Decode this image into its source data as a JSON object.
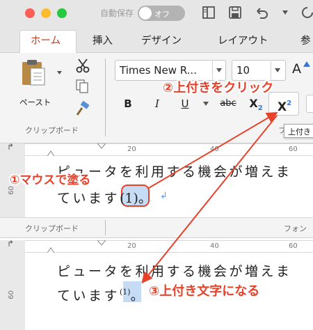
{
  "titlebar": {
    "autosave_label": "自動保存",
    "toggle_label": "オフ"
  },
  "tabs": [
    "ホーム",
    "挿入",
    "デザイン",
    "レイアウト",
    "参"
  ],
  "clipboard": {
    "paste_label": "ペースト",
    "group_label": "クリップボード"
  },
  "font": {
    "name": "Times New R...",
    "size": "10",
    "grow_label": "A"
  },
  "format_buttons": {
    "bold": "B",
    "italic": "I",
    "underline": "U",
    "strike": "abc",
    "subscript": "X",
    "subscript_mark": "2",
    "superscript": "X",
    "superscript_mark": "2"
  },
  "tooltip": "上付き",
  "ruler_top": {
    "marks": [
      "20",
      "40",
      "60"
    ]
  },
  "ruler_bottom": {
    "marks": [
      "20",
      "40",
      "60"
    ]
  },
  "doc_top": {
    "line1": "ピュータを利用する機会が増えま",
    "line2_pre": "ています",
    "line2_sel": "(1)",
    "line2_post": "。",
    "margin_num": "60"
  },
  "second_ribbon": {
    "group_label": "クリップボード",
    "right_label": "フォン"
  },
  "doc_bottom": {
    "line1": "ピュータを利用する機会が増えま",
    "line2_pre": "ています",
    "line2_sup": "(1)",
    "line2_post": "。",
    "margin_num": "60"
  },
  "annotations": {
    "step1": "①マウスで塗る",
    "step2": "②上付きをクリック",
    "step3": "③上付き文字になる"
  },
  "colors": {
    "annotation": "#e8412a",
    "selection": "#c6dcf4",
    "tab_active_text": "#c43e1c"
  }
}
